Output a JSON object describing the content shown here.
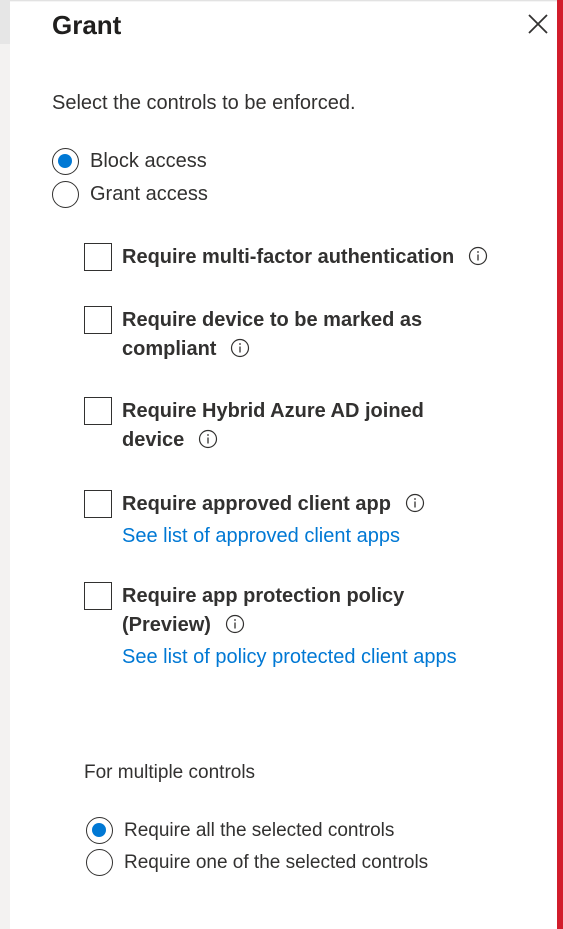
{
  "panel": {
    "title": "Grant",
    "subtitle": "Select the controls to be enforced."
  },
  "access_options": [
    {
      "label": "Block access",
      "checked": true
    },
    {
      "label": "Grant access",
      "checked": false
    }
  ],
  "controls": [
    {
      "label": "Require multi-factor authentication",
      "checked": false,
      "info_icon": "info-icon"
    },
    {
      "label": "Require device to be marked as compliant",
      "checked": false,
      "info_icon": "info-icon"
    },
    {
      "label": "Require Hybrid Azure AD joined device",
      "checked": false,
      "info_icon": "info-icon"
    },
    {
      "label": "Require approved client app",
      "checked": false,
      "info_icon": "info-icon",
      "link": "See list of approved client apps"
    },
    {
      "label": "Require app protection policy (Preview)",
      "checked": false,
      "info_icon": "info-icon",
      "link": "See list of policy protected client apps"
    }
  ],
  "multiple_controls": {
    "label": "For multiple controls",
    "options": [
      {
        "label": "Require all the selected controls",
        "checked": true
      },
      {
        "label": "Require one of the selected controls",
        "checked": false
      }
    ]
  },
  "colors": {
    "accent": "#0078d4",
    "text": "#323130",
    "border_right": "#d21d2b"
  }
}
